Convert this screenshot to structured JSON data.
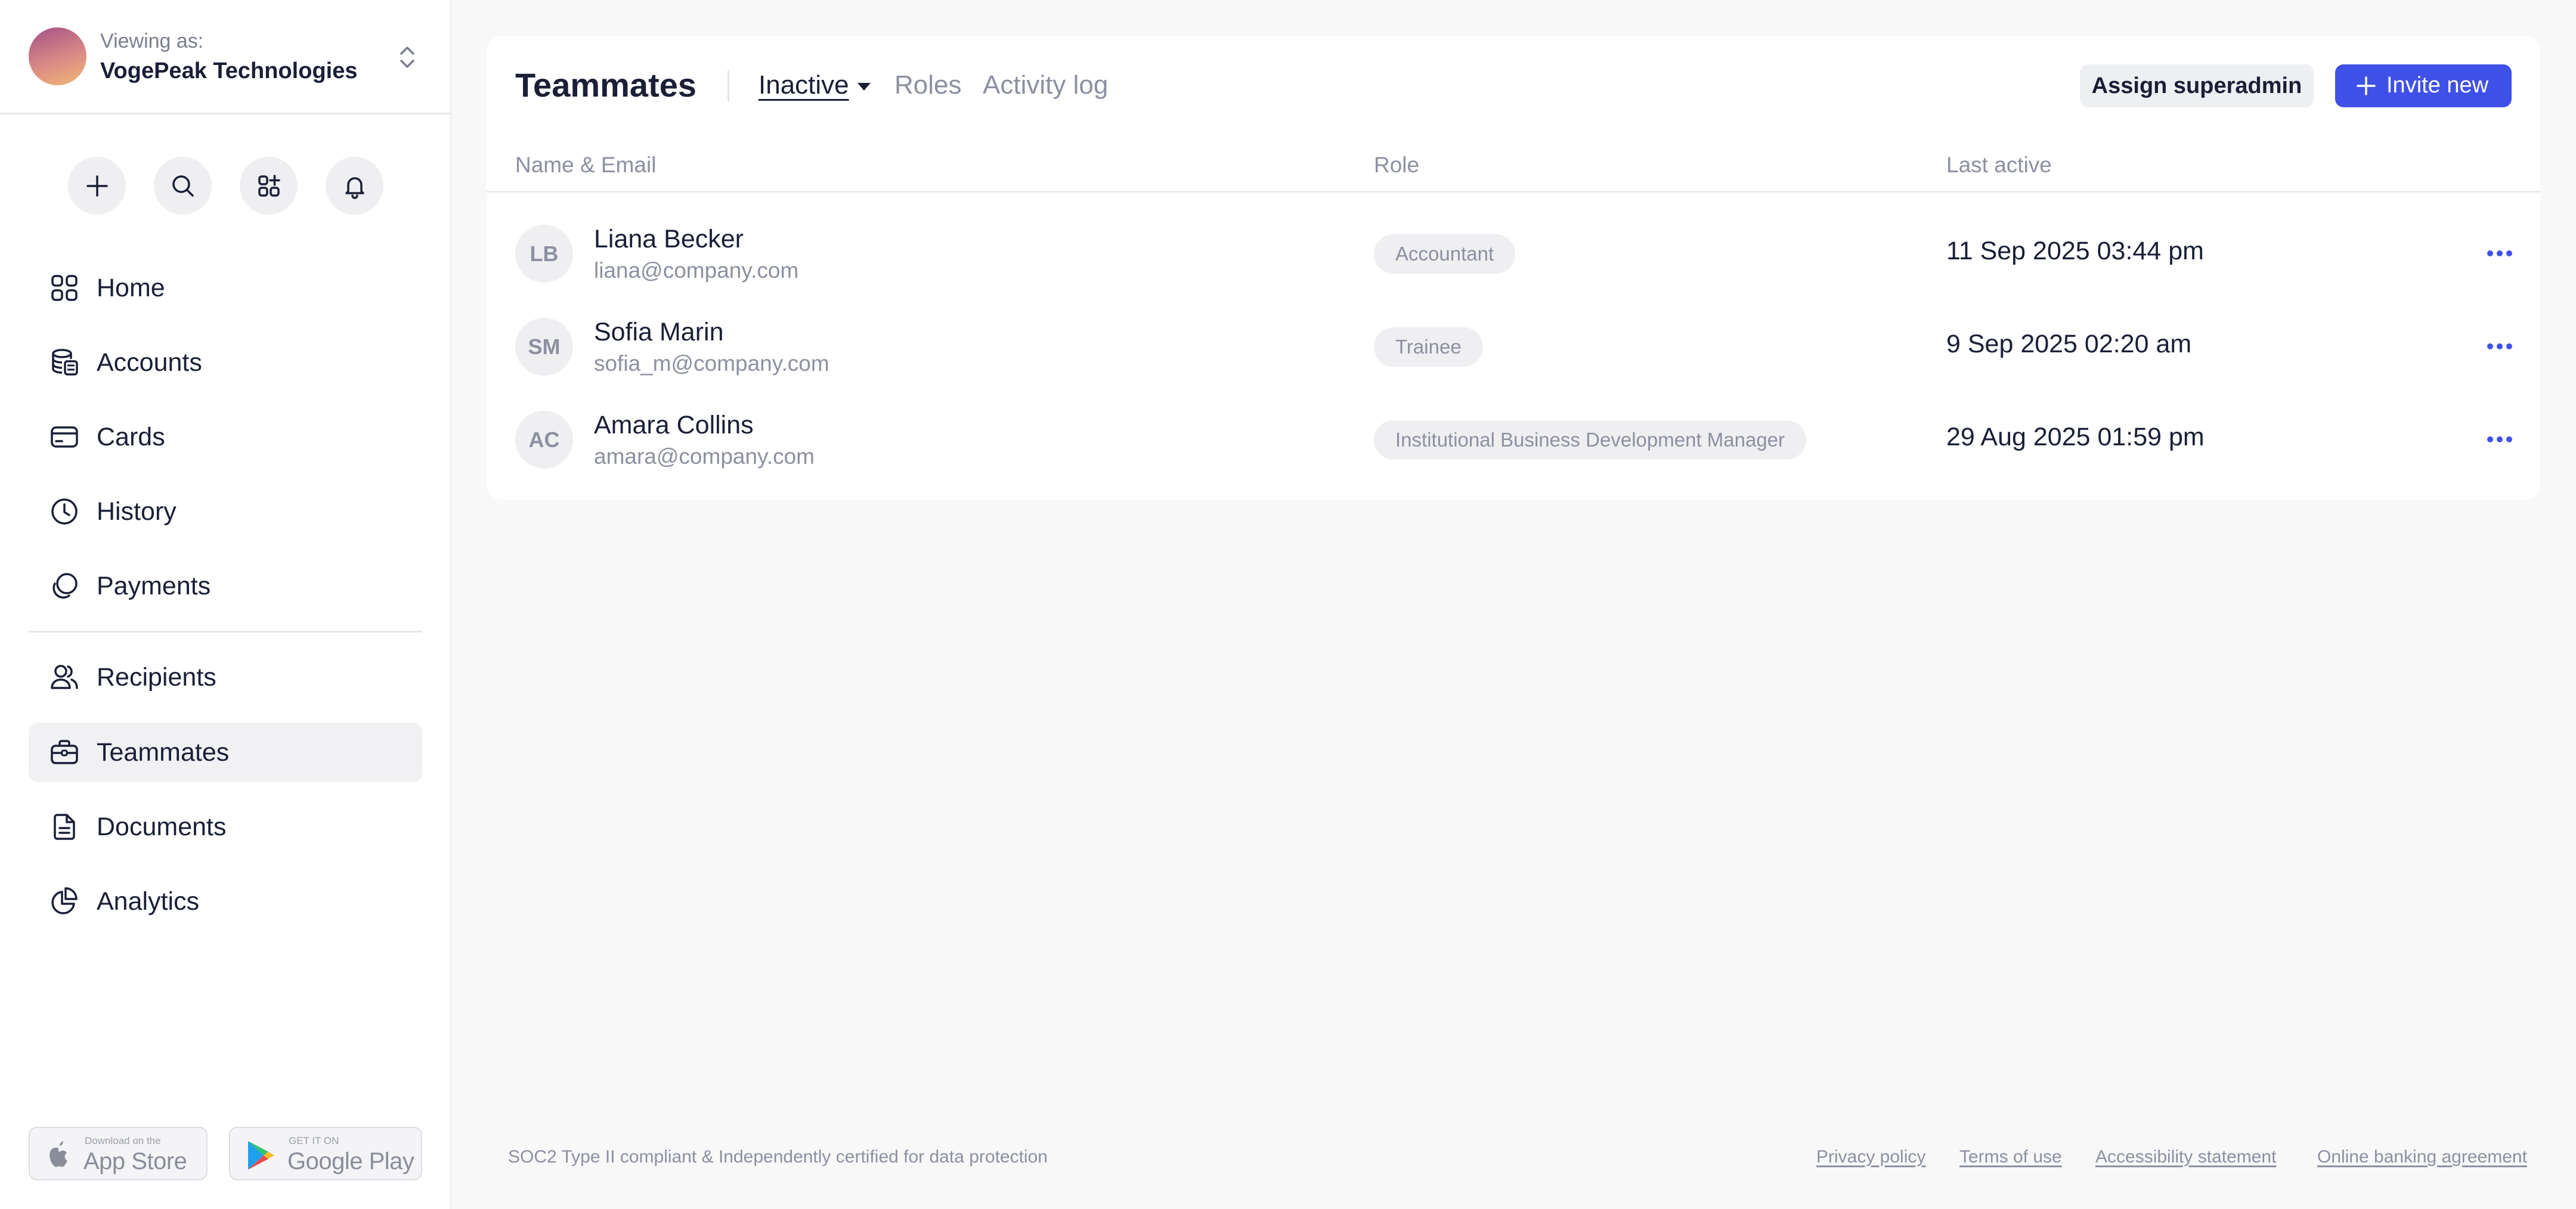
{
  "org": {
    "viewing_label": "Viewing as:",
    "name": "VogePeak Technologies"
  },
  "quick_actions": [
    {
      "icon": "plus-icon"
    },
    {
      "icon": "search-icon"
    },
    {
      "icon": "apps-add-icon"
    },
    {
      "icon": "bell-icon"
    }
  ],
  "nav": {
    "items": [
      {
        "label": "Home",
        "icon": "grid-icon"
      },
      {
        "label": "Accounts",
        "icon": "coins-stack-icon"
      },
      {
        "label": "Cards",
        "icon": "card-icon"
      },
      {
        "label": "History",
        "icon": "clock-icon"
      },
      {
        "label": "Payments",
        "icon": "payments-icon"
      },
      {
        "label": "Recipients",
        "icon": "users-icon"
      },
      {
        "label": "Teammates",
        "icon": "briefcase-icon",
        "active": true
      },
      {
        "label": "Documents",
        "icon": "document-icon"
      },
      {
        "label": "Analytics",
        "icon": "pie-chart-icon"
      }
    ]
  },
  "stores": {
    "app_store": {
      "small": "Download on the",
      "big": "App Store"
    },
    "google_play": {
      "small": "GET IT ON",
      "big": "Google Play"
    }
  },
  "page": {
    "title": "Teammates",
    "tabs": [
      {
        "label": "Inactive",
        "active": true
      },
      {
        "label": "Roles"
      },
      {
        "label": "Activity log"
      }
    ],
    "assign_button": "Assign superadmin",
    "invite_button": "Invite new"
  },
  "table": {
    "columns": [
      "Name & Email",
      "Role",
      "Last active"
    ],
    "rows": [
      {
        "initials": "LB",
        "name": "Liana Becker",
        "email": "liana@company.com",
        "role": "Accountant",
        "last_active": "11 Sep 2025 03:44 pm"
      },
      {
        "initials": "SM",
        "name": "Sofia Marin",
        "email": "sofia_m@company.com",
        "role": "Trainee",
        "last_active": "9 Sep 2025 02:20 am"
      },
      {
        "initials": "AC",
        "name": "Amara Collins",
        "email": "amara@company.com",
        "role": "Institutional Business Development Manager",
        "last_active": "29 Aug 2025 01:59 pm"
      }
    ]
  },
  "footer": {
    "compliance": "SOC2 Type II compliant & Independently certified for data protection",
    "links": [
      "Privacy policy",
      "Terms of use",
      "Accessibility statement",
      "Online banking agreement"
    ]
  },
  "colors": {
    "accent": "#3f51e8",
    "text": "#1a1f36",
    "muted": "#8c90a0",
    "background": "#f8f8f9"
  }
}
